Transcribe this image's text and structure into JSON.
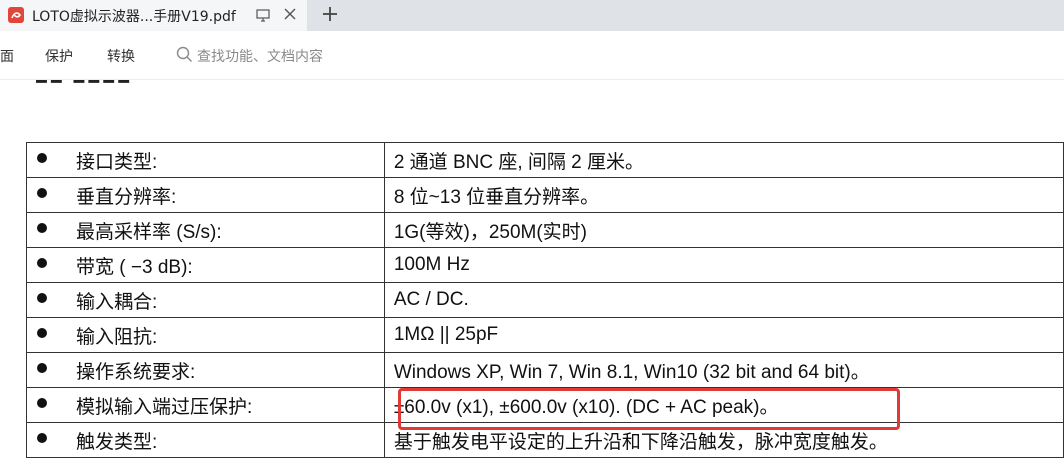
{
  "tab": {
    "title": "LOTO虚拟示波器...手册V19.pdf",
    "icon": "pdf-icon"
  },
  "toolbar": {
    "partial_item": "面",
    "protect": "保护",
    "convert": "转换",
    "search_placeholder": "查找功能、文档内容"
  },
  "specs": [
    {
      "label": "接口类型:",
      "value": "2 通道 BNC 座, 间隔 2 厘米。"
    },
    {
      "label": "垂直分辨率:",
      "value": "8 位~13 位垂直分辨率。"
    },
    {
      "label": "最高采样率 (S/s):",
      "value": "1G(等效)，250M(实时)"
    },
    {
      "label": "带宽 ( −3 dB):",
      "value": "100M Hz"
    },
    {
      "label": "输入耦合:",
      "value": "AC / DC."
    },
    {
      "label": "输入阻抗:",
      "value": "1MΩ || 25pF"
    },
    {
      "label": "操作系统要求:",
      "value": "Windows XP, Win 7, Win 8.1, Win10 (32 bit and 64 bit)。"
    },
    {
      "label": "模拟输入端过压保护:",
      "value": "±60.0v (x1), ±600.0v (x10). (DC + AC peak)。"
    },
    {
      "label": "触发类型:",
      "value": "基于触发电平设定的上升沿和下降沿触发，脉冲宽度触发。"
    }
  ],
  "colors": {
    "highlight": "#e03a36",
    "pdf_icon": "#e0463a"
  }
}
